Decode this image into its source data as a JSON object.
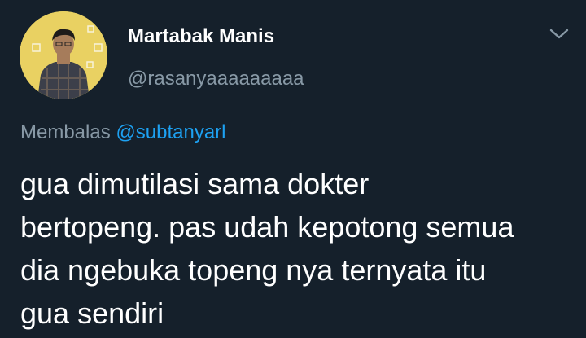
{
  "author": {
    "display_name": "Martabak Manis",
    "handle": "@rasanyaaaaaaaaa",
    "avatar_icon": "profile-photo"
  },
  "menu_icon": "chevron-down-icon",
  "reply": {
    "prefix": "Membalas",
    "mention": "@subtanyarl"
  },
  "tweet_text": {
    "lines": [
      "gua dimutilasi sama dokter",
      "bertopeng. pas udah kepotong semua",
      "dia ngebuka topeng nya ternyata itu",
      "gua sendiri"
    ]
  },
  "colors": {
    "background": "#15202b",
    "primary_text": "#ffffff",
    "secondary_text": "#8899a6",
    "accent": "#1da1f2",
    "avatar_bg": "#e9d162"
  }
}
